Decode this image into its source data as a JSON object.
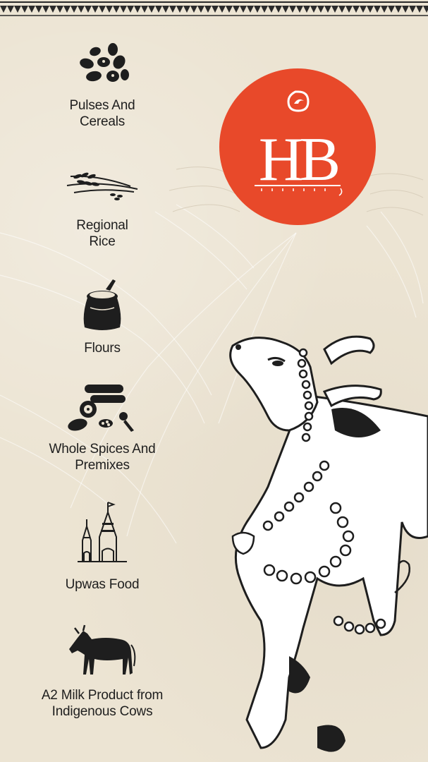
{
  "brand": {
    "logo_text": "HB",
    "colors": {
      "logo_bg": "#e8492a",
      "background": "#ece4d3",
      "ink": "#1e1e1e",
      "logo_text": "#ffffff"
    }
  },
  "categories": [
    {
      "label": "Pulses And\nCereals",
      "icon": "beans-icon"
    },
    {
      "label": "Regional\nRice",
      "icon": "rice-grain-stalk-icon"
    },
    {
      "label": "Flours",
      "icon": "flour-sack-icon"
    },
    {
      "label": "Whole Spices And\nPremixes",
      "icon": "spices-icon"
    },
    {
      "label": "Upwas Food",
      "icon": "temple-icon"
    },
    {
      "label": "A2 Milk Product from\nIndigenous Cows",
      "icon": "cow-icon"
    }
  ]
}
